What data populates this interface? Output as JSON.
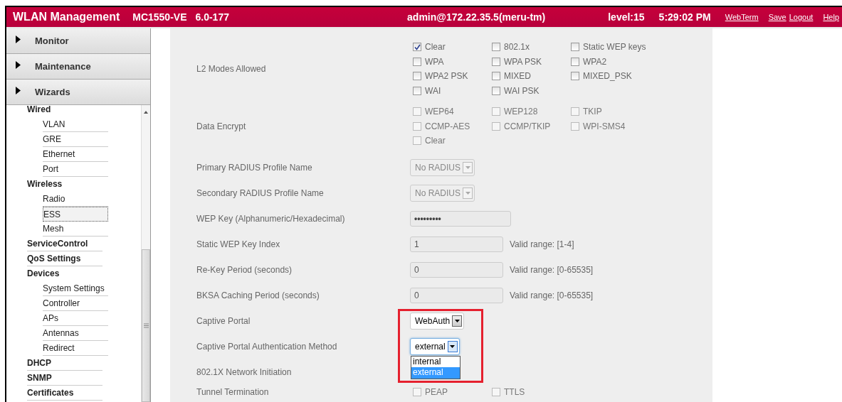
{
  "header": {
    "title": "WLAN Management",
    "model": "MC1550-VE",
    "version": "6.0-177",
    "user": "admin@172.22.35.5(meru-tm)",
    "level": "level:15",
    "time": "5:29:02 PM",
    "links": [
      "WebTerm",
      "Save",
      "Logout",
      "Help"
    ]
  },
  "sidebar": {
    "sections": [
      {
        "label": "Monitor",
        "expanded": false
      },
      {
        "label": "Maintenance",
        "expanded": false
      },
      {
        "label": "Wizards",
        "expanded": false
      }
    ],
    "tree": [
      {
        "label": "Wired",
        "selected": false,
        "children": [
          {
            "label": "VLAN",
            "selected": false
          },
          {
            "label": "GRE",
            "selected": false
          },
          {
            "label": "Ethernet",
            "selected": false
          },
          {
            "label": "Port",
            "selected": false
          }
        ]
      },
      {
        "label": "Wireless",
        "selected": false,
        "children": [
          {
            "label": "Radio",
            "selected": false
          },
          {
            "label": "ESS",
            "selected": true
          },
          {
            "label": "Mesh",
            "selected": false
          }
        ]
      },
      {
        "label": "ServiceControl",
        "selected": false
      },
      {
        "label": "QoS Settings",
        "selected": false
      },
      {
        "label": "Devices",
        "selected": false,
        "children": [
          {
            "label": "System Settings",
            "selected": false
          },
          {
            "label": "Controller",
            "selected": false
          },
          {
            "label": "APs",
            "selected": false
          },
          {
            "label": "Antennas",
            "selected": false
          },
          {
            "label": "Redirect",
            "selected": false
          }
        ]
      },
      {
        "label": "DHCP",
        "selected": false
      },
      {
        "label": "SNMP",
        "selected": false
      },
      {
        "label": "Certificates",
        "selected": false
      }
    ]
  },
  "form": {
    "rows": [
      {
        "label": "L2 Modes Allowed",
        "kind": "checkboxes",
        "disabled": false,
        "highlighted": false,
        "options": [
          {
            "label": "Clear",
            "checked": true
          },
          {
            "label": "802.1x",
            "checked": false
          },
          {
            "label": "Static WEP keys",
            "checked": false
          },
          {
            "label": "WPA",
            "checked": false
          },
          {
            "label": "WPA PSK",
            "checked": false
          },
          {
            "label": "WPA2",
            "checked": false
          },
          {
            "label": "WPA2 PSK",
            "checked": false
          },
          {
            "label": "MIXED",
            "checked": false
          },
          {
            "label": "MIXED_PSK",
            "checked": false
          },
          {
            "label": "WAI",
            "checked": false
          },
          {
            "label": "WAI PSK",
            "checked": false
          }
        ]
      },
      {
        "label": "Data Encrypt",
        "kind": "checkboxes",
        "disabled": true,
        "highlighted": false,
        "options": [
          {
            "label": "WEP64",
            "checked": false
          },
          {
            "label": "WEP128",
            "checked": false
          },
          {
            "label": "TKIP",
            "checked": false
          },
          {
            "label": "CCMP-AES",
            "checked": false
          },
          {
            "label": "CCMP/TKIP",
            "checked": false
          },
          {
            "label": "WPI-SMS4",
            "checked": false
          },
          {
            "label": "Clear",
            "checked": false
          }
        ]
      },
      {
        "label": "Primary RADIUS Profile Name",
        "kind": "select",
        "disabled": true,
        "highlighted": false,
        "value": "No RADIUS"
      },
      {
        "label": "Secondary RADIUS Profile Name",
        "kind": "select",
        "disabled": true,
        "highlighted": false,
        "value": "No RADIUS"
      },
      {
        "label": "WEP Key (Alphanumeric/Hexadecimal)",
        "kind": "password",
        "disabled": true,
        "highlighted": false,
        "value": "•••••••••"
      },
      {
        "label": "Static WEP Key Index",
        "kind": "text",
        "disabled": true,
        "highlighted": false,
        "value": "1",
        "hint": "Valid range: [1-4]"
      },
      {
        "label": "Re-Key Period (seconds)",
        "kind": "text",
        "disabled": true,
        "highlighted": false,
        "value": "0",
        "hint": "Valid range: [0-65535]"
      },
      {
        "label": "BKSA Caching Period (seconds)",
        "kind": "text",
        "disabled": true,
        "highlighted": false,
        "value": "0",
        "hint": "Valid range: [0-65535]"
      },
      {
        "label": "Captive Portal",
        "kind": "select",
        "disabled": false,
        "highlighted": true,
        "value": "WebAuth"
      },
      {
        "label": "Captive Portal Authentication Method",
        "kind": "select",
        "disabled": false,
        "highlighted": true,
        "focused": true,
        "value": "external",
        "options": [
          {
            "label": "internal",
            "selected": false
          },
          {
            "label": "external",
            "selected": true
          }
        ]
      },
      {
        "label": "802.1X Network Initiation",
        "highlighted": false
      },
      {
        "label": "Tunnel Termination",
        "kind": "checkboxes",
        "disabled": true,
        "highlighted": false,
        "options": [
          {
            "label": "PEAP",
            "checked": false
          },
          {
            "label": "TTLS",
            "checked": false
          }
        ]
      }
    ]
  }
}
